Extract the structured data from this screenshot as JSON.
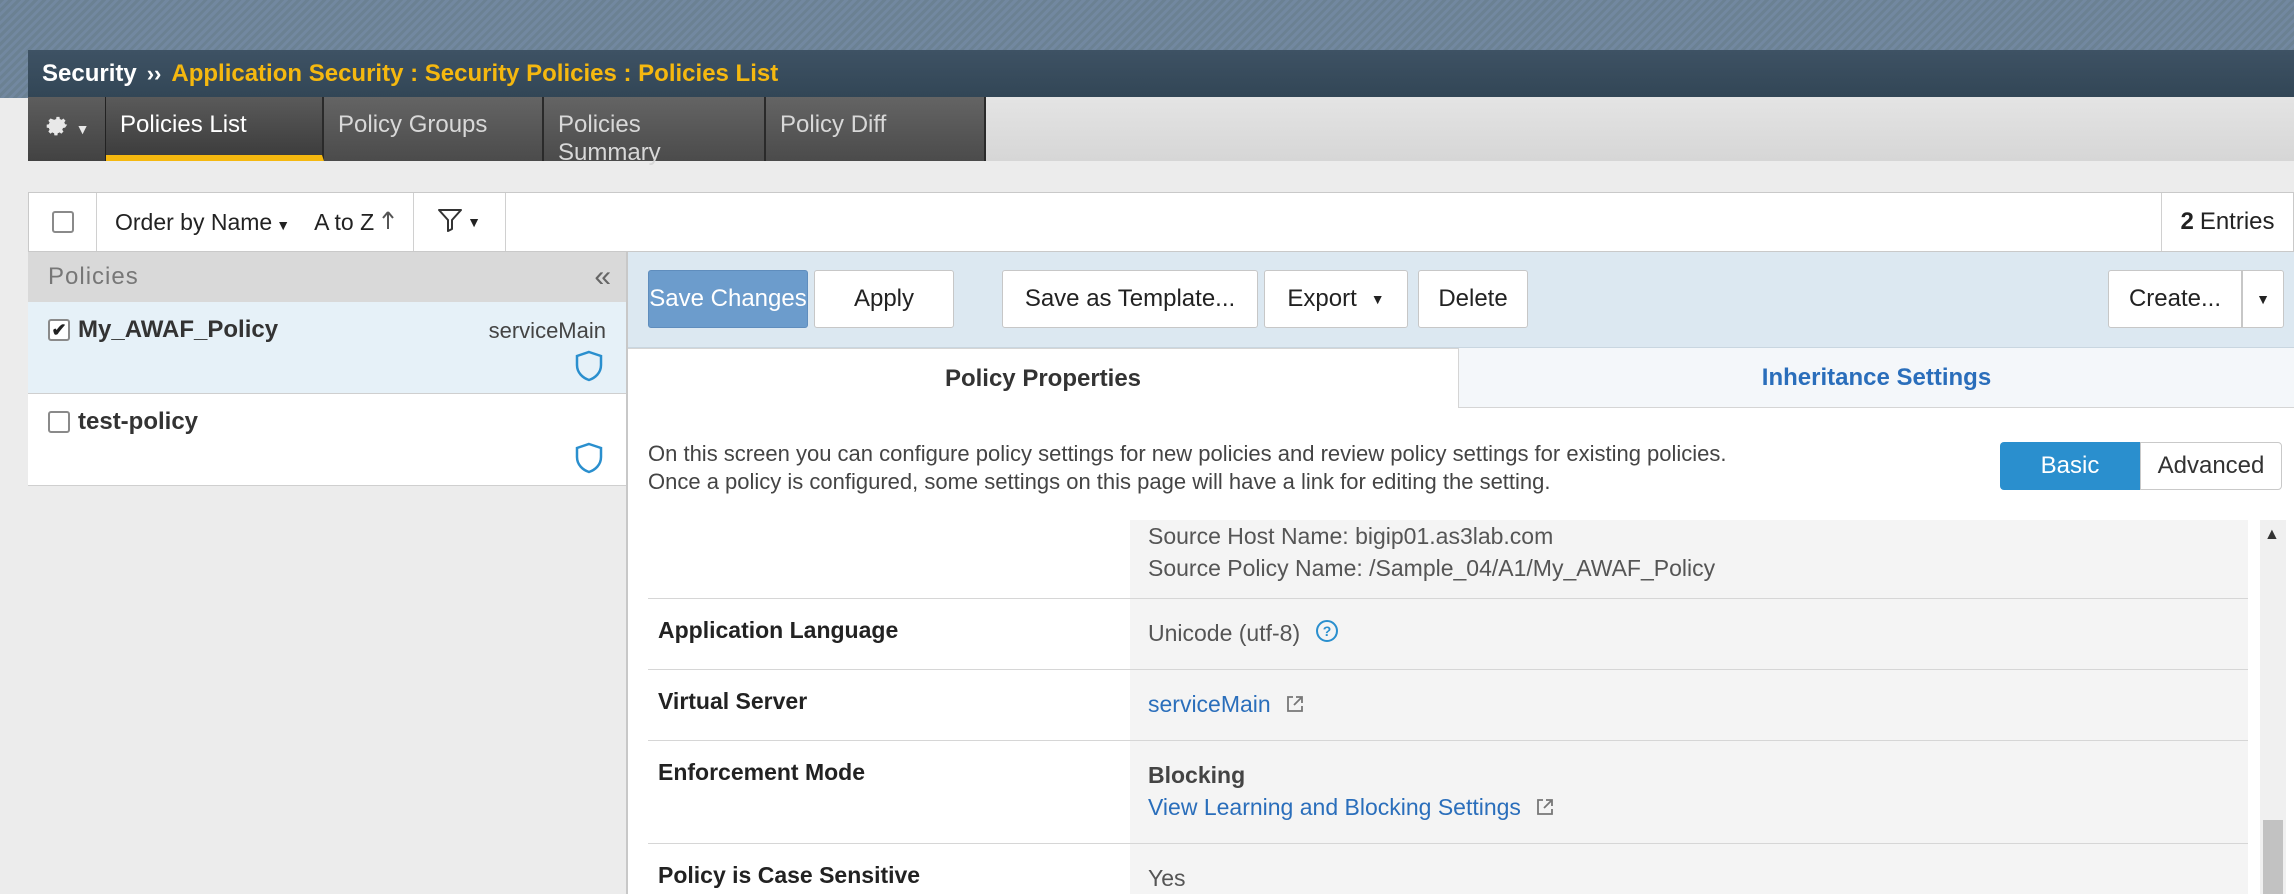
{
  "breadcrumb": {
    "root": "Security",
    "separator": "››",
    "path": "Application Security : Security Policies : Policies List"
  },
  "tabs": [
    {
      "label": "Policies List",
      "active": true
    },
    {
      "label": "Policy Groups",
      "active": false
    },
    {
      "label": "Policies Summary",
      "active": false
    },
    {
      "label": "Policy Diff",
      "active": false
    }
  ],
  "toolbar": {
    "order_label": "Order by Name",
    "sort_label": "A to Z",
    "entries_count": "2",
    "entries_label": "Entries"
  },
  "left_panel": {
    "header": "Policies",
    "collapse_glyph": "«",
    "policies": [
      {
        "name": "My_AWAF_Policy",
        "virtual_server": "serviceMain",
        "checked": true
      },
      {
        "name": "test-policy",
        "virtual_server": "",
        "checked": false
      }
    ]
  },
  "actions": {
    "save": "Save Changes",
    "apply": "Apply",
    "template": "Save as Template...",
    "export": "Export",
    "delete": "Delete",
    "create": "Create..."
  },
  "property_tabs": {
    "properties": "Policy Properties",
    "inheritance": "Inheritance Settings"
  },
  "description": {
    "line1": "On this screen you can configure policy settings for new policies and review policy settings for existing policies.",
    "line2": "Once a policy is configured, some settings on this page will have a link for editing the setting."
  },
  "mode_toggle": {
    "basic": "Basic",
    "advanced": "Advanced"
  },
  "properties": {
    "source_host": "Source Host Name: bigip01.as3lab.com",
    "source_policy": "Source Policy Name: /Sample_04/A1/My_AWAF_Policy",
    "language_label": "Application Language",
    "language_value": "Unicode (utf-8)",
    "virtual_server_label": "Virtual Server",
    "virtual_server_value": "serviceMain",
    "enforcement_label": "Enforcement Mode",
    "enforcement_value": "Blocking",
    "enforcement_link": "View Learning and Blocking Settings",
    "case_label": "Policy is Case Sensitive",
    "case_value": "Yes"
  },
  "colors": {
    "accent_yellow": "#f5b80f",
    "primary_blue": "#2a8fce",
    "link_blue": "#2a6ebb",
    "save_button": "#6c9ccc"
  },
  "icons": {
    "gear": "gear-icon",
    "filter": "filter-icon",
    "shield": "shield-icon",
    "help": "help-icon",
    "external_link": "external-link-icon",
    "sort_arrow": "arrow-up-icon"
  }
}
